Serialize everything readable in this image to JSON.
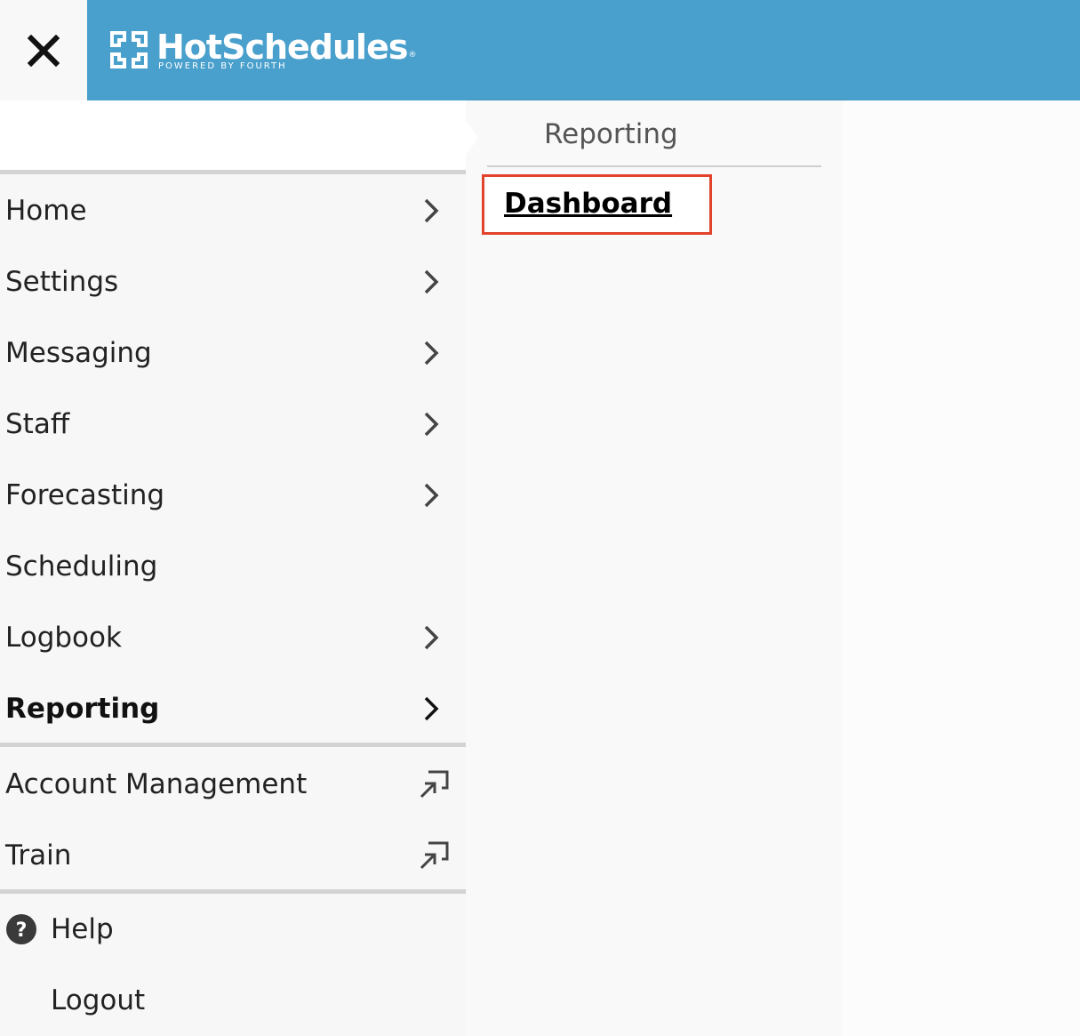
{
  "header": {
    "close_icon": "close-icon",
    "brand_name": "HotSchedules",
    "brand_tagline": "POWERED BY FOURTH",
    "brand_mark": "®",
    "background_color": "#4aa0cc"
  },
  "nav": {
    "items": [
      {
        "label": "Home",
        "icon": "chevron-right-icon"
      },
      {
        "label": "Settings",
        "icon": "chevron-right-icon"
      },
      {
        "label": "Messaging",
        "icon": "chevron-right-icon"
      },
      {
        "label": "Staff",
        "icon": "chevron-right-icon"
      },
      {
        "label": "Forecasting",
        "icon": "chevron-right-icon"
      },
      {
        "label": "Scheduling"
      },
      {
        "label": "Logbook",
        "icon": "chevron-right-icon"
      },
      {
        "label": "Reporting",
        "icon": "chevron-right-icon",
        "active": true
      }
    ],
    "external": [
      {
        "label": "Account Management",
        "icon": "external-link-icon"
      },
      {
        "label": "Train",
        "icon": "external-link-icon"
      }
    ],
    "footer": [
      {
        "label": "Help",
        "icon": "help-circle-icon"
      },
      {
        "label": "Logout"
      }
    ]
  },
  "submenu": {
    "title": "Reporting",
    "items": [
      {
        "label": "Dashboard",
        "highlighted": true
      }
    ],
    "highlight_color": "#e1432b"
  }
}
